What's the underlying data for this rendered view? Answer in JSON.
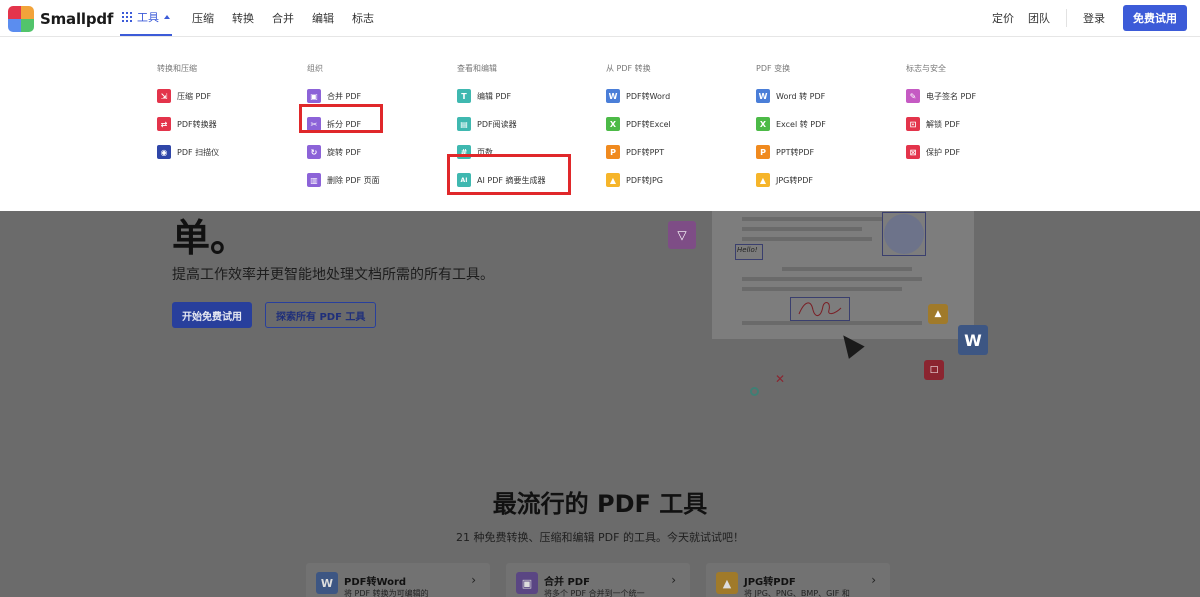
{
  "header": {
    "brand": "Smallpdf",
    "tools_label": "工具",
    "nav": [
      "压缩",
      "转换",
      "合并",
      "编辑",
      "标志"
    ],
    "pricing": "定价",
    "team": "团队",
    "login": "登录",
    "trial_button": "免费试用"
  },
  "menu": {
    "columns": [
      {
        "title": "转换和压缩",
        "items": [
          {
            "label": "压缩 PDF",
            "icon": "compress-icon",
            "color": "red"
          },
          {
            "label": "PDF转换器",
            "icon": "converter-icon",
            "color": "red"
          },
          {
            "label": "PDF 扫描仪",
            "icon": "scanner-icon",
            "color": "navy"
          }
        ]
      },
      {
        "title": "组织",
        "items": [
          {
            "label": "合并 PDF",
            "icon": "merge-icon",
            "color": "purple"
          },
          {
            "label": "拆分 PDF",
            "icon": "split-icon",
            "color": "purple"
          },
          {
            "label": "旋转 PDF",
            "icon": "rotate-icon",
            "color": "purple"
          },
          {
            "label": "删除 PDF 页面",
            "icon": "delete-pages-icon",
            "color": "purple"
          }
        ]
      },
      {
        "title": "查看和编辑",
        "items": [
          {
            "label": "编辑 PDF",
            "icon": "edit-icon",
            "color": "teal"
          },
          {
            "label": "PDF阅读器",
            "icon": "reader-icon",
            "color": "teal"
          },
          {
            "label": "页数",
            "icon": "page-numbers-icon",
            "color": "teal"
          },
          {
            "label": "AI PDF 摘要生成器",
            "icon": "ai-summary-icon",
            "color": "teal"
          }
        ]
      },
      {
        "title": "从 PDF 转换",
        "items": [
          {
            "label": "PDF转Word",
            "icon": "word-icon",
            "color": "blue"
          },
          {
            "label": "PDF转Excel",
            "icon": "excel-icon",
            "color": "green"
          },
          {
            "label": "PDF转PPT",
            "icon": "ppt-icon",
            "color": "orange"
          },
          {
            "label": "PDF转JPG",
            "icon": "jpg-icon",
            "color": "yellow"
          }
        ]
      },
      {
        "title": "PDF 变换",
        "items": [
          {
            "label": "Word 转 PDF",
            "icon": "word-icon",
            "color": "blue"
          },
          {
            "label": "Excel 转 PDF",
            "icon": "excel-icon",
            "color": "green"
          },
          {
            "label": "PPT转PDF",
            "icon": "ppt-icon",
            "color": "orange"
          },
          {
            "label": "JPG转PDF",
            "icon": "jpg-icon",
            "color": "yellow"
          }
        ]
      },
      {
        "title": "标志与安全",
        "items": [
          {
            "label": "电子签名 PDF",
            "icon": "esign-icon",
            "color": "magenta"
          },
          {
            "label": "解锁 PDF",
            "icon": "unlock-icon",
            "color": "pink"
          },
          {
            "label": "保护 PDF",
            "icon": "protect-icon",
            "color": "pink"
          }
        ]
      }
    ]
  },
  "hero": {
    "title_tail": "单。",
    "subtitle": "提高工作效率并更智能地处理文档所需的所有工具。",
    "primary_button": "开始免费试用",
    "secondary_button": "探索所有 PDF 工具",
    "hello_label": "Hello!"
  },
  "popular": {
    "title": "最流行的 PDF 工具",
    "subtitle": "21 种免费转换、压缩和编辑 PDF 的工具。今天就试试吧！",
    "cards": [
      {
        "title": "PDF转Word",
        "desc": "将 PDF 转换为可编辑的"
      },
      {
        "title": "合并 PDF",
        "desc": "将多个 PDF 合并到一个统一"
      },
      {
        "title": "JPG转PDF",
        "desc": "将 JPG、PNG、BMP、GIF 和"
      }
    ]
  },
  "colors": {
    "accent": "#3c5bd8",
    "highlight": "#e0282a"
  }
}
